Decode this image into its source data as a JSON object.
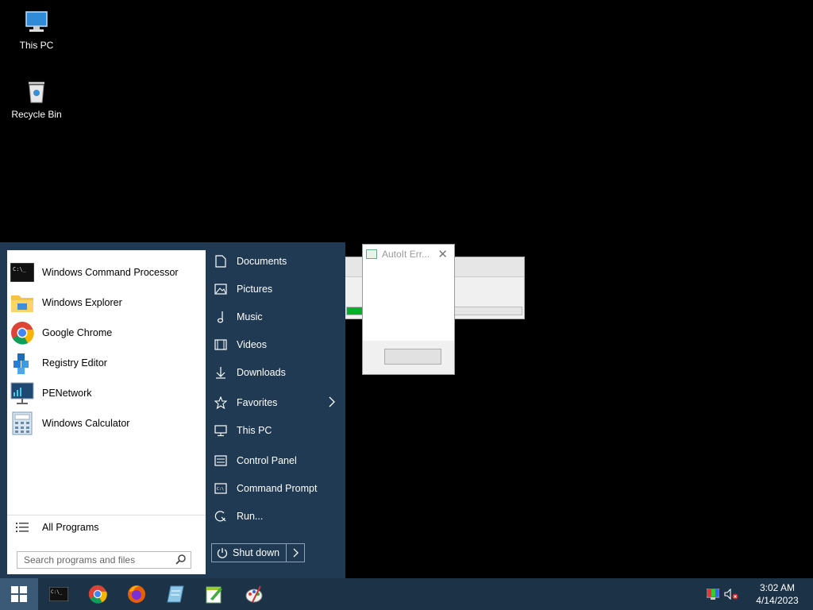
{
  "desktop": {
    "icons": [
      {
        "label": "This PC",
        "icon": "computer-icon"
      },
      {
        "label": "Recycle Bin",
        "icon": "recycle-bin-icon"
      }
    ]
  },
  "background_window": {
    "progress_fraction": 0.09,
    "progress_color": "#06b025"
  },
  "autoit_dialog": {
    "title": "AutoIt Err...",
    "close_glyph": "✕"
  },
  "start_menu": {
    "programs": [
      {
        "label": "Windows Command Processor",
        "icon": "cmd-icon"
      },
      {
        "label": "Windows Explorer",
        "icon": "folder-icon"
      },
      {
        "label": "Google Chrome",
        "icon": "chrome-icon"
      },
      {
        "label": "Registry Editor",
        "icon": "registry-icon"
      },
      {
        "label": "PENetwork",
        "icon": "network-icon"
      },
      {
        "label": "Windows Calculator",
        "icon": "calculator-icon"
      }
    ],
    "all_programs": "All Programs",
    "search_placeholder": "Search programs and files",
    "right_links": [
      {
        "label": "Documents",
        "icon": "document-icon"
      },
      {
        "label": "Pictures",
        "icon": "picture-icon"
      },
      {
        "label": "Music",
        "icon": "music-icon"
      },
      {
        "label": "Videos",
        "icon": "video-icon"
      },
      {
        "label": "Downloads",
        "icon": "download-icon"
      },
      {
        "label": "Favorites",
        "icon": "star-icon"
      },
      {
        "label": "This PC",
        "icon": "monitor-icon"
      },
      {
        "label": "Control Panel",
        "icon": "control-panel-icon"
      },
      {
        "label": "Command Prompt",
        "icon": "terminal-icon"
      },
      {
        "label": "Run...",
        "icon": "run-icon"
      }
    ],
    "shutdown_label": "Shut down"
  },
  "taskbar": {
    "pinned": [
      "cmd-icon",
      "chrome-icon",
      "firefox-icon",
      "notepad-icon",
      "editor-icon",
      "paint-icon"
    ],
    "clock": {
      "time": "3:02 AM",
      "date": "4/14/2023"
    },
    "accent": "#1c3347"
  }
}
